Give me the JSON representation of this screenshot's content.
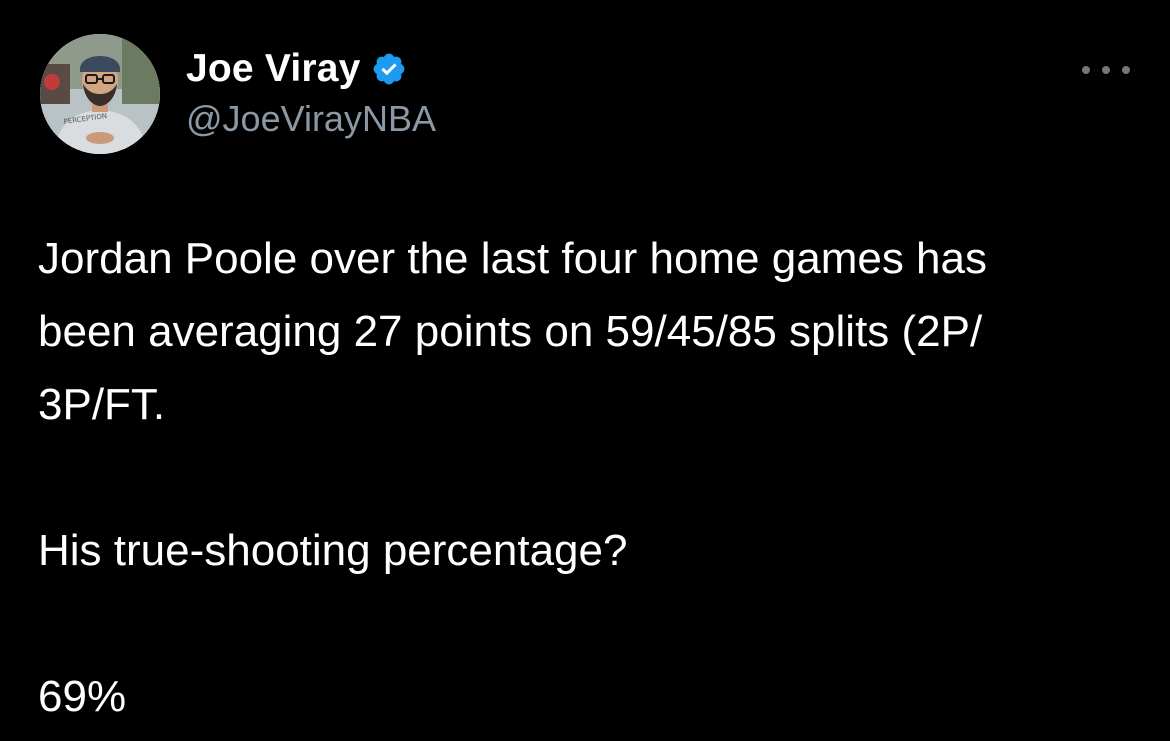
{
  "author": {
    "display_name": "Joe Viray",
    "handle": "@JoeVirayNBA",
    "verified": true,
    "avatar_shirt_text": "PERCEPTION"
  },
  "tweet": {
    "paragraph_1_line_1": "Jordan Poole over the last four home games has",
    "paragraph_1_line_2": "been averaging 27 points on 59/45/85 splits (2P/",
    "paragraph_1_line_3": "3P/FT.",
    "paragraph_2": "His true-shooting percentage?",
    "paragraph_3": "69%"
  },
  "icons": {
    "verified": "verified-badge-icon",
    "more": "more-options-icon"
  },
  "colors": {
    "background": "#000000",
    "text": "#ffffff",
    "secondary_text": "#8b98a5",
    "verified_blue": "#1d9bf0",
    "icon_gray": "#71767b"
  }
}
